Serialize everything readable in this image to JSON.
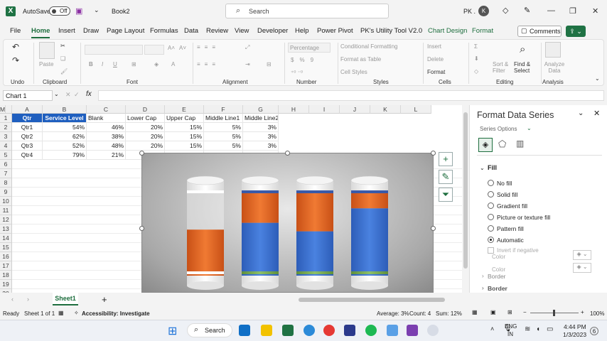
{
  "titlebar": {
    "autosave_label": "AutoSave",
    "autosave_state": "Off",
    "book": "Book2",
    "search_placeholder": "Search",
    "user": "PK ."
  },
  "tabs": [
    "File",
    "Home",
    "Insert",
    "Draw",
    "Page Layout",
    "Formulas",
    "Data",
    "Review",
    "View",
    "Developer",
    "Help",
    "Power Pivot",
    "PK's Utility Tool V2.0",
    "Chart Design",
    "Format"
  ],
  "comments_label": "Comments",
  "ribbon": {
    "undo_group": "Undo",
    "clipboard_group": "Clipboard",
    "paste": "Paste",
    "font_group": "Font",
    "alignment_group": "Alignment",
    "number_group": "Number",
    "number_format": "Percentage",
    "styles_group": "Styles",
    "cond_format": "Conditional Formatting",
    "format_table": "Format as Table",
    "cell_styles": "Cell Styles",
    "cells_group": "Cells",
    "insert": "Insert",
    "delete": "Delete",
    "format": "Format",
    "editing_group": "Editing",
    "sort_filter": "Sort & Filter",
    "find_select": "Find & Select",
    "analysis_group": "Analysis",
    "analyze_data": "Analyze Data"
  },
  "namebox": "Chart 1",
  "fx": "fx",
  "columns": [
    "A",
    "B",
    "C",
    "D",
    "E",
    "F",
    "G",
    "H",
    "I",
    "J",
    "K",
    "L",
    "M"
  ],
  "rows": [
    "1",
    "2",
    "3",
    "4",
    "5",
    "6",
    "7",
    "8",
    "9",
    "10",
    "11",
    "12",
    "13",
    "14",
    "15",
    "16",
    "17",
    "18",
    "19",
    "20"
  ],
  "table": {
    "headers": [
      "Qtr",
      "Service Level",
      "Blank",
      "Lower Cap",
      "Upper Cap",
      "Middle Line1",
      "Middle Line2"
    ],
    "data": [
      [
        "Qtr1",
        "54%",
        "46%",
        "20%",
        "15%",
        "5%",
        "3%"
      ],
      [
        "Qtr2",
        "62%",
        "38%",
        "20%",
        "15%",
        "5%",
        "3%"
      ],
      [
        "Qtr3",
        "52%",
        "48%",
        "20%",
        "15%",
        "5%",
        "3%"
      ],
      [
        "Qtr4",
        "79%",
        "21%",
        "",
        "",
        "",
        ""
      ]
    ]
  },
  "chart_data": {
    "type": "bar",
    "categories": [
      "Qtr1",
      "Qtr2",
      "Qtr3",
      "Qtr4"
    ],
    "series": [
      {
        "name": "Service Level",
        "values": [
          54,
          62,
          52,
          79
        ]
      },
      {
        "name": "Blank",
        "values": [
          46,
          38,
          48,
          21
        ]
      }
    ]
  },
  "pane": {
    "title": "Format Data Series",
    "series_options": "Series Options",
    "fill_section": "Fill",
    "options": [
      "No fill",
      "Solid fill",
      "Gradient fill",
      "Picture or texture fill",
      "Pattern fill",
      "Automatic"
    ],
    "selected": "Automatic",
    "invert": "Invert if negative",
    "color1": "Color",
    "color2": "Color",
    "border1": "Border",
    "border2": "Border"
  },
  "sheet_tab": "Sheet1",
  "status": {
    "ready": "Ready",
    "sheet": "Sheet 1 of 1",
    "accessibility": "Accessibility: Investigate",
    "average": "Average: 3%",
    "count": "Count: 4",
    "sum": "Sum: 12%",
    "zoom": "100%"
  },
  "taskbar": {
    "search": "Search",
    "lang1": "ENG",
    "lang2": "IN",
    "time": "4:44 PM",
    "date": "1/3/2023",
    "badge": "6"
  },
  "colors": {
    "excel_green": "#1f7244",
    "header_blue": "#1f5fbf",
    "orange": "#e8661f",
    "blue": "#3a6fcf"
  }
}
